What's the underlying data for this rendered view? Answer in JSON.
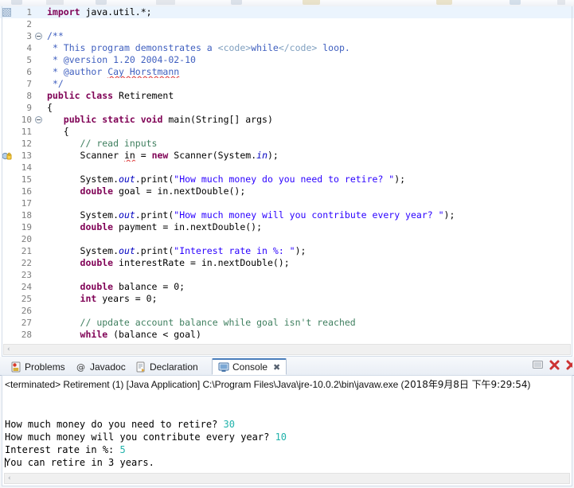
{
  "toolbar": {
    "icons": [
      "save-icon",
      "print-icon",
      "debug-icon",
      "run-icon",
      "search-icon",
      "open-type-icon"
    ]
  },
  "editor": {
    "name": "java-source-editor",
    "current_line": 1,
    "lines": [
      {
        "num": "1",
        "marker": "current-line-marker",
        "fold": "",
        "html": "<span class=\"kw\">import</span> java.util.*;"
      },
      {
        "num": "2",
        "marker": "",
        "fold": "",
        "html": ""
      },
      {
        "num": "3",
        "marker": "",
        "fold": "collapse",
        "html": "<span class=\"jdoc\">/**</span>"
      },
      {
        "num": "4",
        "marker": "",
        "fold": "",
        "html": " <span class=\"jdoc\">* This program demonstrates a </span><span class=\"jtag\">&lt;code&gt;</span><span class=\"jdoc\">while</span><span class=\"jtag\">&lt;/code&gt;</span><span class=\"jdoc\"> loop.</span>"
      },
      {
        "num": "5",
        "marker": "",
        "fold": "",
        "html": " <span class=\"jdoc\">* @version 1.20 2004-02-10</span>"
      },
      {
        "num": "6",
        "marker": "",
        "fold": "",
        "html": " <span class=\"jdoc\">* @author </span><span class=\"jdoc spell\">Cay Horstmann</span>"
      },
      {
        "num": "7",
        "marker": "",
        "fold": "",
        "html": " <span class=\"jdoc\">*/</span>"
      },
      {
        "num": "8",
        "marker": "",
        "fold": "",
        "html": "<span class=\"kw\">public class</span> Retirement"
      },
      {
        "num": "9",
        "marker": "",
        "fold": "",
        "html": "{"
      },
      {
        "num": "10",
        "marker": "",
        "fold": "collapse",
        "html": "   <span class=\"kw\">public static void</span> main(String[] args)"
      },
      {
        "num": "11",
        "marker": "",
        "fold": "",
        "html": "   {"
      },
      {
        "num": "12",
        "marker": "",
        "fold": "",
        "html": "      <span class=\"cmt\">// read inputs</span>"
      },
      {
        "num": "13",
        "marker": "warning-marker",
        "fold": "",
        "html": "      Scanner <span class=\"spell\">in</span> = <span class=\"kw\">new</span> Scanner(System.<span class=\"fld\">in</span>);"
      },
      {
        "num": "14",
        "marker": "",
        "fold": "",
        "html": ""
      },
      {
        "num": "15",
        "marker": "",
        "fold": "",
        "html": "      System.<span class=\"fld\">out</span>.print(<span class=\"str\">\"How much money do you need to retire? \"</span>);"
      },
      {
        "num": "16",
        "marker": "",
        "fold": "",
        "html": "      <span class=\"kw\">double</span> goal = in.nextDouble();"
      },
      {
        "num": "17",
        "marker": "",
        "fold": "",
        "html": ""
      },
      {
        "num": "18",
        "marker": "",
        "fold": "",
        "html": "      System.<span class=\"fld\">out</span>.print(<span class=\"str\">\"How much money will you contribute every year? \"</span>);"
      },
      {
        "num": "19",
        "marker": "",
        "fold": "",
        "html": "      <span class=\"kw\">double</span> payment = in.nextDouble();"
      },
      {
        "num": "20",
        "marker": "",
        "fold": "",
        "html": ""
      },
      {
        "num": "21",
        "marker": "",
        "fold": "",
        "html": "      System.<span class=\"fld\">out</span>.print(<span class=\"str\">\"Interest rate in %: \"</span>);"
      },
      {
        "num": "22",
        "marker": "",
        "fold": "",
        "html": "      <span class=\"kw\">double</span> interestRate = in.nextDouble();"
      },
      {
        "num": "23",
        "marker": "",
        "fold": "",
        "html": ""
      },
      {
        "num": "24",
        "marker": "",
        "fold": "",
        "html": "      <span class=\"kw\">double</span> balance = 0;"
      },
      {
        "num": "25",
        "marker": "",
        "fold": "",
        "html": "      <span class=\"kw\">int</span> years = 0;"
      },
      {
        "num": "26",
        "marker": "",
        "fold": "",
        "html": ""
      },
      {
        "num": "27",
        "marker": "",
        "fold": "",
        "html": "      <span class=\"cmt\">// update account balance while goal isn't reached</span>"
      },
      {
        "num": "28",
        "marker": "",
        "fold": "",
        "html": "      <span class=\"kw\">while</span> (balance &lt; goal)"
      }
    ],
    "scroll_left_arrow": "‹"
  },
  "console_panel": {
    "tabs": [
      {
        "label": "Problems",
        "icon": "problems-icon",
        "active": false,
        "closable": false
      },
      {
        "label": "Javadoc",
        "icon": "javadoc-icon",
        "active": false,
        "closable": false
      },
      {
        "label": "Declaration",
        "icon": "declaration-icon",
        "active": false,
        "closable": false
      },
      {
        "label": "Console",
        "icon": "console-icon",
        "active": true,
        "closable": true
      }
    ],
    "close_glyph": "✖",
    "actions": [
      {
        "name": "display-selected-console-button",
        "icon": "terminal-icon"
      },
      {
        "name": "remove-launch-button",
        "icon": "red-x-icon"
      },
      {
        "name": "remove-all-terminated-button",
        "icon": "red-xx-icon"
      }
    ],
    "terminated_line": {
      "prefix": "<terminated> Retirement (1) [Java Application] C:\\Program Files\\Java\\jre-10.0.2\\bin\\javaw.exe (",
      "date_cjk": "2018年9月8日 下午9:29:54",
      "suffix": ")"
    },
    "output": [
      {
        "prompt": "How much money do you need to retire? ",
        "input": "30"
      },
      {
        "prompt": "How much money will you contribute every year? ",
        "input": "10"
      },
      {
        "prompt": "Interest rate in %: ",
        "input": "5"
      },
      {
        "prompt": "You can retire in 3 years.",
        "input": ""
      }
    ],
    "scroll_left_arrow": "‹"
  },
  "colors": {
    "keyword": "#7f0055",
    "string": "#2a00ff",
    "comment": "#3f7f5f",
    "javadoc": "#3f5fbf",
    "javadoc_tag": "#7f9fbf",
    "static_field": "#0000c0",
    "console_input": "#20b2aa",
    "current_line_bg": "#ebf4fd",
    "tab_active_top": "#4a7ebb"
  }
}
